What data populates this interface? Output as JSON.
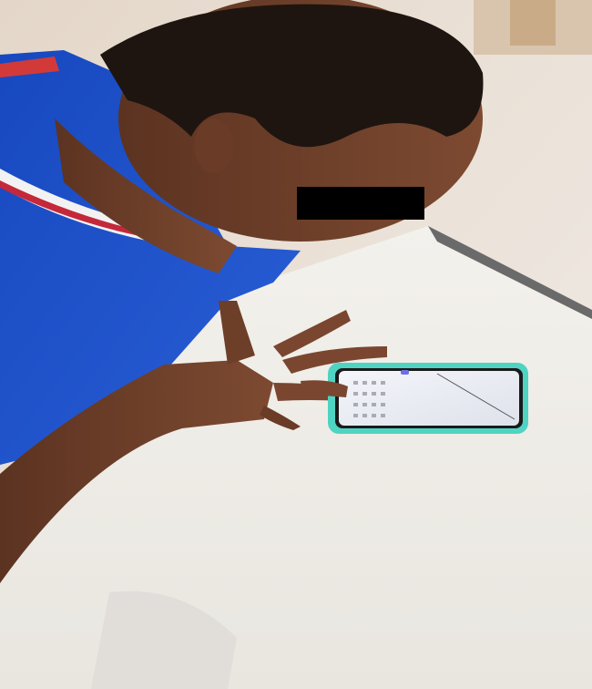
{
  "scene": {
    "subject": "person-looking-at-phone",
    "objects": [
      "blue-shirt",
      "white-table",
      "smartphone",
      "teal-phone-case",
      "privacy-bar"
    ]
  },
  "colors": {
    "shirt": "#1f4fc4",
    "shirt_stripe_red": "#c4283a",
    "shirt_stripe_white": "#f2f2f2",
    "skin": "#6e3f28",
    "hair": "#1e1510",
    "table": "#efece6",
    "floor": "#e9e3dc",
    "phone_case": "#4fd3c2",
    "phone_screen": "#eef0f6",
    "privacy_bar": "#000000"
  }
}
